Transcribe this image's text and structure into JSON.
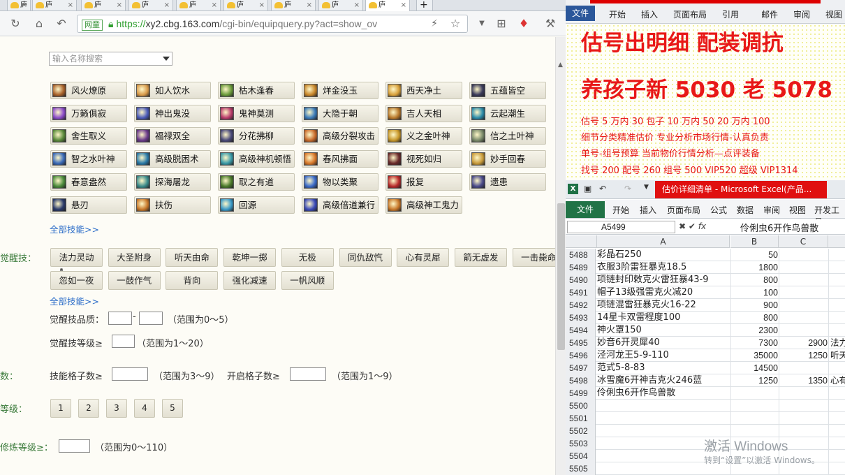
{
  "browser": {
    "tab_glyph": "庐",
    "tab_close": "×",
    "new_tab": "+",
    "badge": "网童",
    "lock_icon": "lock-icon",
    "url_scheme": "https://",
    "url_host": "xy2.cbg.163.com",
    "url_path": "/cgi-bin/equipquery.py?act=show_ov"
  },
  "search": {
    "placeholder": "输入名称搜索"
  },
  "skills": [
    "风火燎原",
    "如人饮水",
    "枯木逢春",
    "烊金没玉",
    "西天净土",
    "五蕴皆空",
    "万籁俱寂",
    "神出鬼没",
    "鬼神莫测",
    "大隐于朝",
    "吉人天相",
    "云起潮生",
    "舍生取义",
    "福禄双全",
    "分花拂柳",
    "高级分裂攻击",
    "义之金叶神",
    "信之土叶神",
    "智之水叶神",
    "高级脱困术",
    "高级神机顿悟",
    "春风拂面",
    "视死如归",
    "妙手回春",
    "春意盎然",
    "探海屠龙",
    "取之有道",
    "物以类聚",
    "报复",
    "遗患",
    "悬刃",
    "扶伤",
    "回源",
    "高级倍道兼行",
    "高级神工鬼力"
  ],
  "skill_icon_colors": [
    "#a8612a",
    "#d89a4a",
    "#6a9a3a",
    "#c8862a",
    "#d8a03a",
    "#3a3a5a",
    "#8a4ac8",
    "#4a5ab8",
    "#b83a6a",
    "#3a7ab8",
    "#b8782a",
    "#2a8aa8",
    "#5a8a3a",
    "#6a3a8a",
    "#4a4a7a",
    "#c86a2a",
    "#c8982a",
    "#7a8a6a",
    "#3a6ab8",
    "#2a7aa8",
    "#3a9aa8",
    "#d8782a",
    "#6a2a2a",
    "#c89a3a",
    "#4a8a3a",
    "#3a8a8a",
    "#4a7a2a",
    "#3a6ac8",
    "#b82a2a",
    "#4a4a8a",
    "#2a3a6a",
    "#c8782a",
    "#3a9ac8",
    "#3a4ab8",
    "#c8782a"
  ],
  "links": {
    "all_skills_1": "全部技能>>",
    "all_skills_2": "全部技能>>"
  },
  "awaken": {
    "label": "觉醒技：",
    "buttons": [
      "法力灵动",
      "大圣附身",
      "听天由命",
      "乾坤一掷",
      "无极",
      "同仇敌忾",
      "心有灵犀",
      "箭无虚发",
      "一击毙命",
      "忽如一夜",
      "一鼓作气",
      "背向",
      "强化减速",
      "一帆风顺"
    ],
    "quality_label": "觉醒技品质：",
    "quality_sep": "-",
    "quality_range": "（范围为0～5）",
    "level_label": "觉醒技等级≥",
    "level_range": "（范围为1～20）"
  },
  "slots": {
    "label": "数：",
    "skill_slots_label": "技能格子数≥",
    "skill_slots_range": "（范围为3～9）",
    "open_slots_label": "开启格子数≥",
    "open_slots_range": "（范围为1～9）"
  },
  "level": {
    "label": "等级：",
    "options": [
      "1",
      "2",
      "3",
      "4",
      "5"
    ]
  },
  "cultivation": {
    "label": "修炼等级≥：",
    "range": "（范围为0～110）"
  },
  "word": {
    "tabs": [
      "文件",
      "开始",
      "插入",
      "页面布局",
      "引用",
      "邮件",
      "审阅",
      "视图"
    ],
    "line1": "估号出明细  配装调抗",
    "line2": "养孩子新 5030 老 5078",
    "line3": "估号 5 万内 30 包子   10 万内 50  20 万内 100",
    "line4": "细节分类精准估价   专业分析市场行情-认真负责",
    "line5": "单号-组号预算     当前物价行情分析—点评装备",
    "line6": "找号 200     配号 260     组号 500  VIP520      超级 VIP1314"
  },
  "excel": {
    "title": "估价详细清单 - Microsoft Excel(产品...",
    "tabs": [
      "文件",
      "开始",
      "插入",
      "页面布局",
      "公式",
      "数据",
      "审阅",
      "视图",
      "开发工具"
    ],
    "name_box": "A5499",
    "fx_label": "fx",
    "formula_value": "伶俐虫6开作鸟兽散",
    "columns": [
      "A",
      "B",
      "C"
    ],
    "rows": [
      {
        "n": "5488",
        "a": "彩晶石250",
        "b": "50",
        "c": "",
        "d": ""
      },
      {
        "n": "5489",
        "a": "衣服3阶雷狂暴克18.5",
        "b": "1800",
        "c": "",
        "d": ""
      },
      {
        "n": "5490",
        "a": "项链封印敕克火雷狂暴43-9",
        "b": "800",
        "c": "",
        "d": ""
      },
      {
        "n": "5491",
        "a": "帽子13级强雷克火减20",
        "b": "100",
        "c": "",
        "d": ""
      },
      {
        "n": "5492",
        "a": "项链混雷狂暴克火16-22",
        "b": "900",
        "c": "",
        "d": ""
      },
      {
        "n": "5493",
        "a": "14星卡双雷程度100",
        "b": "800",
        "c": "",
        "d": ""
      },
      {
        "n": "5494",
        "a": "神火罩150",
        "b": "2300",
        "c": "",
        "d": ""
      },
      {
        "n": "5495",
        "a": "妙音6开灵犀40",
        "b": "7300",
        "c": "2900",
        "d": "法力"
      },
      {
        "n": "5496",
        "a": "泾河龙王5-9-110",
        "b": "35000",
        "c": "1250",
        "d": "听天"
      },
      {
        "n": "5497",
        "a": "范式5-8-83",
        "b": "14500",
        "c": "",
        "d": ""
      },
      {
        "n": "5498",
        "a": "冰雪魔6开神吉克火246蓝",
        "b": "1250",
        "c": "1350",
        "d": "心有"
      },
      {
        "n": "5499",
        "a": "伶俐虫6开作鸟兽散",
        "b": "",
        "c": "",
        "d": ""
      },
      {
        "n": "5500",
        "a": "",
        "b": "",
        "c": "",
        "d": ""
      },
      {
        "n": "5501",
        "a": "",
        "b": "",
        "c": "",
        "d": ""
      },
      {
        "n": "5502",
        "a": "",
        "b": "",
        "c": "",
        "d": ""
      },
      {
        "n": "5503",
        "a": "",
        "b": "",
        "c": "",
        "d": ""
      },
      {
        "n": "5504",
        "a": "",
        "b": "",
        "c": "",
        "d": ""
      },
      {
        "n": "5505",
        "a": "",
        "b": "",
        "c": "",
        "d": ""
      }
    ],
    "watermark_title": "激活 Windows",
    "watermark_sub": "转到“设置”以激活 Windows。"
  }
}
